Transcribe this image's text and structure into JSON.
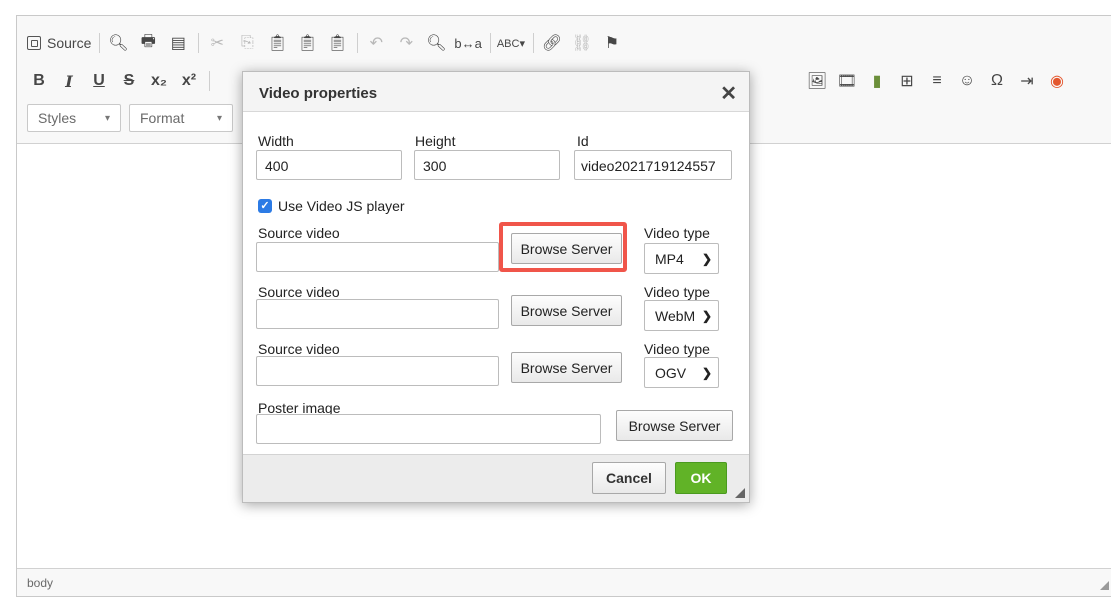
{
  "toolbar": {
    "source_label": "Source",
    "row1_icons": [
      "preview-icon",
      "print-icon",
      "templates-icon",
      "cut-icon",
      "copy-icon",
      "paste-icon",
      "paste-text-icon",
      "paste-word-icon",
      "undo-icon",
      "redo-icon",
      "find-icon",
      "replace-icon",
      "spellcheck-icon",
      "link-icon",
      "unlink-icon",
      "anchor-icon"
    ],
    "row1_glyphs": [
      "🔍︎",
      "🖶",
      "▤",
      "✂",
      "⎘",
      "📋︎",
      "📋︎",
      "📋︎",
      "↶",
      "↷",
      "🔍︎",
      "b↔a",
      "ABC▾",
      "🔗︎",
      "⛓",
      "⚑"
    ],
    "format_buttons": [
      "B",
      "I",
      "U",
      "S",
      "x₂",
      "x²"
    ],
    "row2_right_glyphs": [
      "🖼︎",
      "🎞",
      "▮",
      "⊞",
      "≡",
      "☺",
      "Ω",
      "⇥",
      "◉"
    ],
    "row2_right_icons": [
      "image-icon",
      "flash-icon",
      "video-icon",
      "table-icon",
      "horizontal-line-icon",
      "smiley-icon",
      "special-char-icon",
      "page-break-icon",
      "iframe-icon"
    ],
    "styles_label": "Styles",
    "format_label": "Format"
  },
  "statusbar": {
    "path": "body"
  },
  "dialog": {
    "title": "Video properties",
    "width_label": "Width",
    "width_value": "400",
    "height_label": "Height",
    "height_value": "300",
    "id_label": "Id",
    "id_value": "video2021719124557",
    "use_videojs_label": "Use Video JS player",
    "use_videojs_checked": true,
    "sources": [
      {
        "label": "Source video",
        "value": "",
        "browse_label": "Browse Server",
        "type_label": "Video type",
        "type_value": "MP4"
      },
      {
        "label": "Source video",
        "value": "",
        "browse_label": "Browse Server",
        "type_label": "Video type",
        "type_value": "WebM"
      },
      {
        "label": "Source video",
        "value": "",
        "browse_label": "Browse Server",
        "type_label": "Video type",
        "type_value": "OGV"
      }
    ],
    "poster_label": "Poster image",
    "poster_value": "",
    "poster_browse_label": "Browse Server",
    "cancel_label": "Cancel",
    "ok_label": "OK"
  },
  "colors": {
    "ok_green": "#61b327",
    "highlight_red": "#f0554a",
    "checkbox_blue": "#2c7be5"
  }
}
